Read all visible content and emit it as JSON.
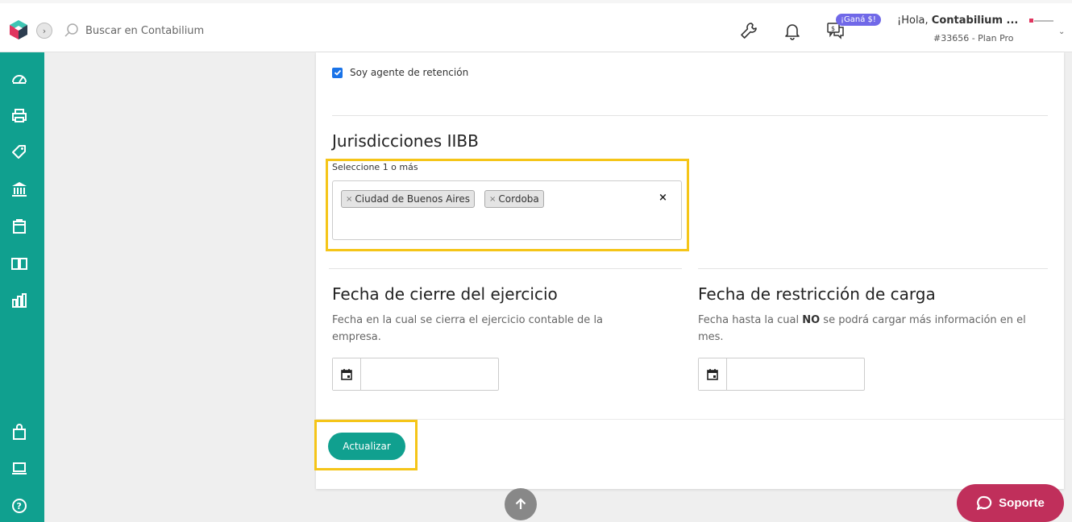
{
  "search": {
    "placeholder": "Buscar en Contabilium"
  },
  "header": {
    "promo_badge": "¡Ganá $!",
    "greeting_prefix": "¡Hola, ",
    "user_name": "Contabilium ...",
    "account_plan": "#33656 - Plan Pro"
  },
  "sidebar": {
    "items": [
      {
        "icon": "dashboard-icon"
      },
      {
        "icon": "printer-icon"
      },
      {
        "icon": "tag-icon"
      },
      {
        "icon": "bank-icon"
      },
      {
        "icon": "box-icon"
      },
      {
        "icon": "book-icon"
      },
      {
        "icon": "bar-chart-icon"
      },
      {
        "icon": "shopping-bag-icon"
      },
      {
        "icon": "laptop-icon"
      },
      {
        "icon": "help-icon"
      }
    ]
  },
  "form": {
    "retention_agent_label": "Soy agente de retención",
    "retention_agent_checked": true,
    "iibb": {
      "title": "Jurisdicciones IIBB",
      "field_label": "Seleccione 1 o más",
      "selected": [
        "Ciudad de Buenos Aires",
        "Cordoba"
      ],
      "clear_symbol": "×",
      "remove_symbol": "×"
    },
    "fiscal_close": {
      "title": "Fecha de cierre del ejercicio",
      "description": "Fecha en la cual se cierra el ejercicio contable de la empresa.",
      "value": ""
    },
    "load_restriction": {
      "title": "Fecha de restricción de carga",
      "description_before": "Fecha hasta la cual ",
      "description_bold": "NO",
      "description_after": " se podrá cargar más información en el mes.",
      "value": ""
    },
    "submit_label": "Actualizar"
  },
  "support": {
    "label": "Soporte"
  },
  "colors": {
    "brand_teal": "#10a08f",
    "support_pink": "#c02f5b",
    "highlight_yellow": "#f5c518",
    "promo_purple": "#7068e8"
  }
}
